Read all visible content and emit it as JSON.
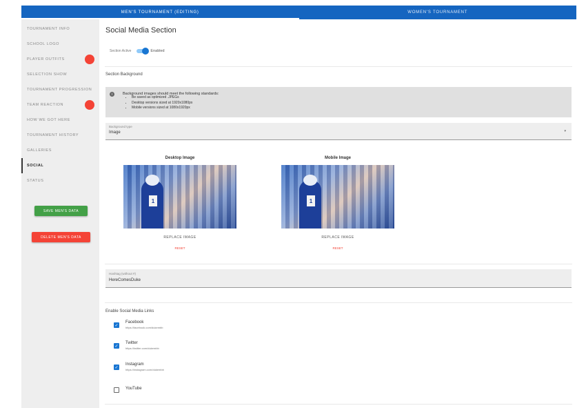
{
  "tabs": [
    {
      "label": "MEN'S TOURNAMENT (EDITING)",
      "active": true
    },
    {
      "label": "WOMEN'S TOURNAMENT",
      "active": false
    }
  ],
  "sidebar": {
    "items": [
      {
        "label": "TOURNAMENT INFO",
        "badge": false,
        "active": false
      },
      {
        "label": "SCHOOL LOGO",
        "badge": false,
        "active": false
      },
      {
        "label": "PLAYER OUTFITS",
        "badge": true,
        "active": false
      },
      {
        "label": "SELECTION SHOW",
        "badge": false,
        "active": false
      },
      {
        "label": "TOURNAMENT PROGRESSION",
        "badge": false,
        "active": false
      },
      {
        "label": "TEAM REACTION",
        "badge": true,
        "active": false
      },
      {
        "label": "HOW WE GOT HERE",
        "badge": false,
        "active": false
      },
      {
        "label": "TOURNAMENT HISTORY",
        "badge": false,
        "active": false
      },
      {
        "label": "GALLERIES",
        "badge": false,
        "active": false
      },
      {
        "label": "SOCIAL",
        "badge": false,
        "active": true
      },
      {
        "label": "STATUS",
        "badge": false,
        "active": false
      }
    ],
    "save_label": "SAVE MEN'S DATA",
    "delete_label": "DELETE MEN'S DATA"
  },
  "main": {
    "title": "Social Media Section",
    "toggle": {
      "label": "Section Active",
      "state": "Enabled",
      "on": true
    },
    "background": {
      "heading": "Section Background",
      "info_title": "Background images should meet the following standards:",
      "info_items": [
        "Be saved as optimized .JPEGs",
        "Desktop versions sized at 1920x1080px",
        "Mobile versions sized at 1080x1920px"
      ],
      "select_label": "Background type",
      "select_value": "Image"
    },
    "images": [
      {
        "title": "Desktop Image",
        "replace_label": "REPLACE IMAGE",
        "reset_label": "RESET"
      },
      {
        "title": "Mobile Image",
        "replace_label": "REPLACE IMAGE",
        "reset_label": "RESET"
      }
    ],
    "handle": {
      "label": "Hashtag (without #)",
      "value": "HereComesDuke"
    },
    "social": {
      "heading": "Enable Social Media Links",
      "links": [
        {
          "name": "Facebook",
          "url": "https://facebook.com/dukembb",
          "checked": true
        },
        {
          "name": "Twitter",
          "url": "https://twitter.com/dukembb",
          "checked": true
        },
        {
          "name": "Instagram",
          "url": "https://instagram.com/dukembb",
          "checked": true
        },
        {
          "name": "YouTube",
          "url": "",
          "checked": false
        }
      ]
    }
  },
  "colors": {
    "brand_blue": "#1565c0",
    "accent_blue": "#1976d2",
    "danger": "#f44336",
    "success": "#43a047"
  }
}
